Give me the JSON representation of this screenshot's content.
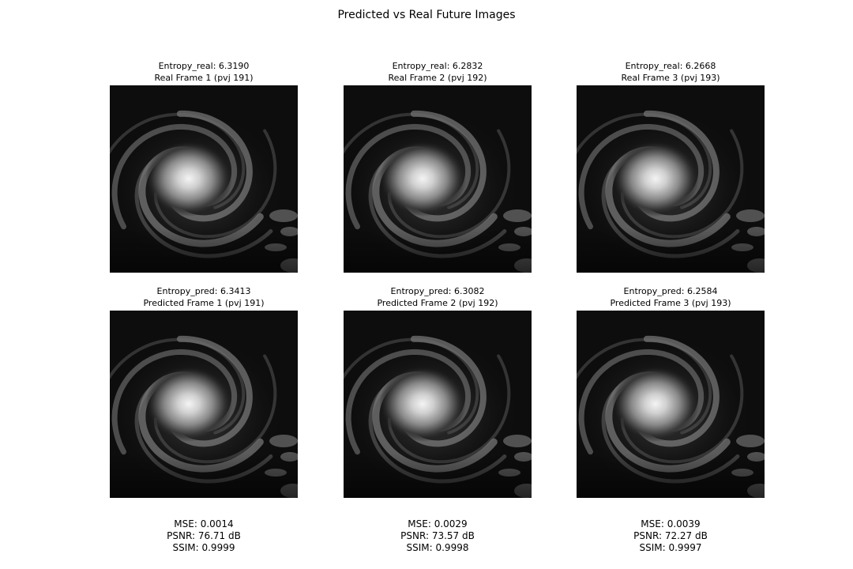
{
  "figure": {
    "title": "Predicted vs Real Future Images"
  },
  "real_frames": [
    {
      "entropy": "Entropy_real: 6.3190",
      "label": "Real Frame 1 (pvj 191)",
      "image": "hurricane-satellite-image"
    },
    {
      "entropy": "Entropy_real: 6.2832",
      "label": "Real Frame 2 (pvj 192)",
      "image": "hurricane-satellite-image"
    },
    {
      "entropy": "Entropy_real: 6.2668",
      "label": "Real Frame 3 (pvj 193)",
      "image": "hurricane-satellite-image"
    }
  ],
  "predicted_frames": [
    {
      "entropy": "Entropy_pred: 6.3413",
      "label": "Predicted Frame 1 (pvj 191)",
      "image": "hurricane-satellite-image"
    },
    {
      "entropy": "Entropy_pred: 6.3082",
      "label": "Predicted Frame 2 (pvj 192)",
      "image": "hurricane-satellite-image"
    },
    {
      "entropy": "Entropy_pred: 6.2584",
      "label": "Predicted Frame 3 (pvj 193)",
      "image": "hurricane-satellite-image"
    }
  ],
  "metrics": [
    {
      "mse": "MSE: 0.0014",
      "psnr": "PSNR: 76.71 dB",
      "ssim": "SSIM: 0.9999"
    },
    {
      "mse": "MSE: 0.0029",
      "psnr": "PSNR: 73.57 dB",
      "ssim": "SSIM: 0.9998"
    },
    {
      "mse": "MSE: 0.0039",
      "psnr": "PSNR: 72.27 dB",
      "ssim": "SSIM: 0.9997"
    }
  ]
}
